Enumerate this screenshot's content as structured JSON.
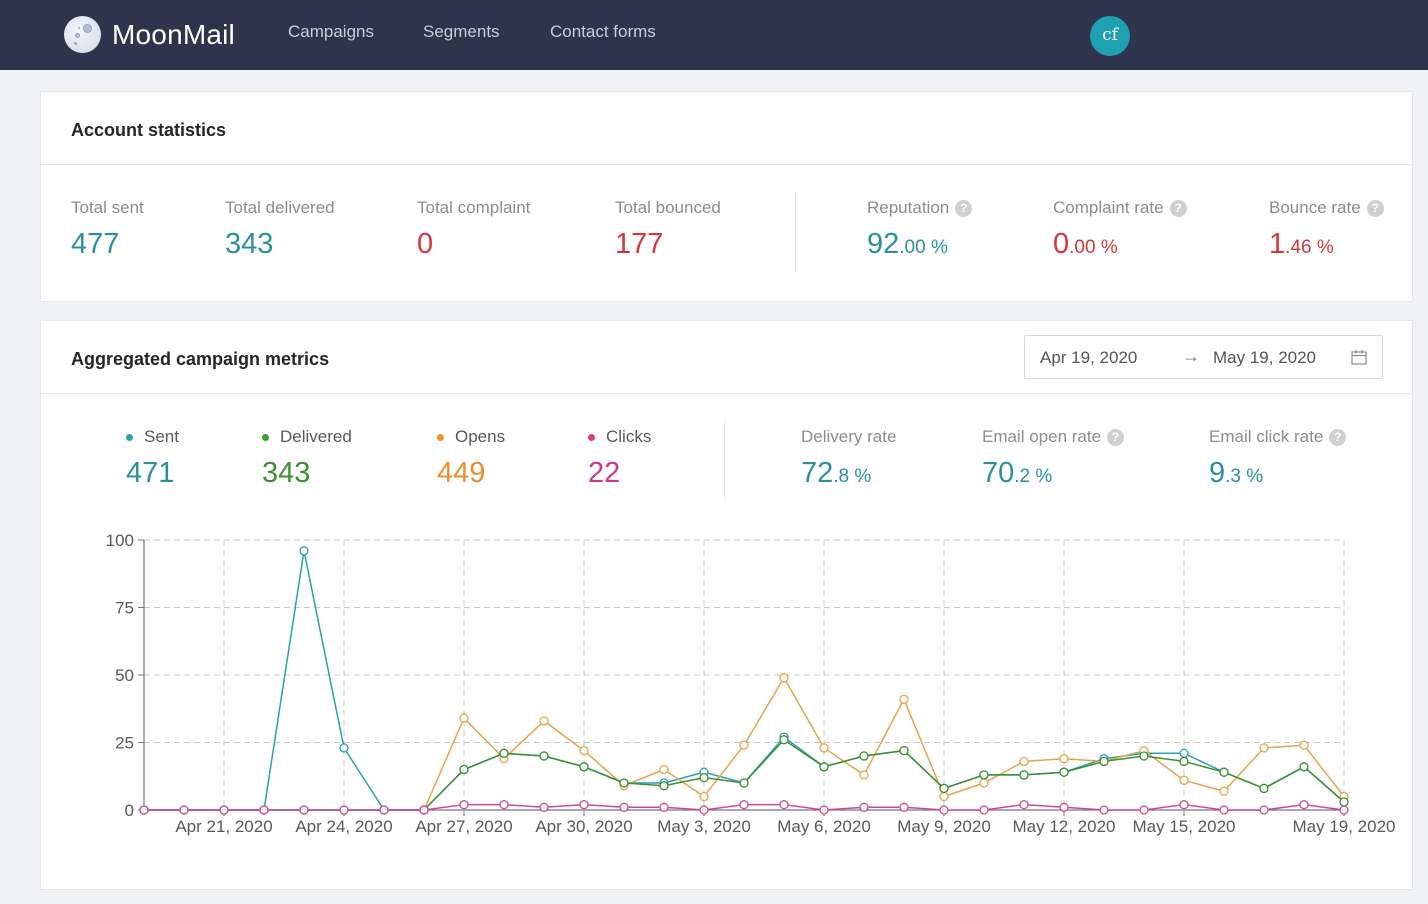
{
  "app": {
    "name": "MoonMail",
    "nav": [
      "Campaigns",
      "Segments",
      "Contact forms"
    ],
    "user_initials": "cf"
  },
  "account_statistics": {
    "title": "Account statistics",
    "totals": [
      {
        "label": "Total sent",
        "value": "477",
        "color": "#2b8f9e"
      },
      {
        "label": "Total delivered",
        "value": "343",
        "color": "#2b8f9e"
      },
      {
        "label": "Total complaint",
        "value": "0",
        "color": "#d4363b"
      },
      {
        "label": "Total bounced",
        "value": "177",
        "color": "#d4363b"
      }
    ],
    "rates": [
      {
        "label": "Reputation",
        "int": "92",
        "dec": ".00 %",
        "color": "#2b8f9e",
        "help": "?"
      },
      {
        "label": "Complaint rate",
        "int": "0",
        "dec": ".00 %",
        "color": "#d4363b",
        "help": "?"
      },
      {
        "label": "Bounce rate",
        "int": "1",
        "dec": ".46 %",
        "color": "#d4363b",
        "help": "?"
      }
    ]
  },
  "campaign_metrics": {
    "title": "Aggregated campaign metrics",
    "date_range": {
      "start": "Apr 19, 2020",
      "arrow": "→",
      "end": "May 19, 2020"
    },
    "counts": [
      {
        "label": "Sent",
        "value": "471",
        "color": "#2aa0b4"
      },
      {
        "label": "Delivered",
        "value": "343",
        "color": "#3aa02a"
      },
      {
        "label": "Opens",
        "value": "449",
        "color": "#f0902a"
      },
      {
        "label": "Clicks",
        "value": "22",
        "color": "#d93a8c"
      }
    ],
    "rates": [
      {
        "label": "Delivery rate",
        "int": "72",
        "dec": ".8 %",
        "help": null
      },
      {
        "label": "Email open rate",
        "int": "70",
        "dec": ".2 %",
        "help": "?"
      },
      {
        "label": "Email click rate",
        "int": "9",
        "dec": ".3 %",
        "help": "?"
      }
    ],
    "rate_color": "#2b8f9e"
  },
  "chart_data": {
    "type": "line",
    "title": "",
    "xlabel": "",
    "ylabel": "",
    "ylim": [
      0,
      100
    ],
    "y_ticks": [
      0,
      25,
      50,
      75,
      100
    ],
    "x": [
      "Apr 19, 2020",
      "Apr 20, 2020",
      "Apr 21, 2020",
      "Apr 22, 2020",
      "Apr 23, 2020",
      "Apr 24, 2020",
      "Apr 25, 2020",
      "Apr 26, 2020",
      "Apr 27, 2020",
      "Apr 28, 2020",
      "Apr 29, 2020",
      "Apr 30, 2020",
      "May 1, 2020",
      "May 2, 2020",
      "May 3, 2020",
      "May 4, 2020",
      "May 5, 2020",
      "May 6, 2020",
      "May 7, 2020",
      "May 8, 2020",
      "May 9, 2020",
      "May 10, 2020",
      "May 11, 2020",
      "May 12, 2020",
      "May 13, 2020",
      "May 14, 2020",
      "May 15, 2020",
      "May 16, 2020",
      "May 17, 2020",
      "May 18, 2020",
      "May 19, 2020"
    ],
    "x_tick_labels": [
      {
        "index": 2,
        "label": "Apr 21, 2020"
      },
      {
        "index": 5,
        "label": "Apr 24, 2020"
      },
      {
        "index": 8,
        "label": "Apr 27, 2020"
      },
      {
        "index": 11,
        "label": "Apr 30, 2020"
      },
      {
        "index": 14,
        "label": "May 3, 2020"
      },
      {
        "index": 17,
        "label": "May 6, 2020"
      },
      {
        "index": 20,
        "label": "May 9, 2020"
      },
      {
        "index": 23,
        "label": "May 12, 2020"
      },
      {
        "index": 26,
        "label": "May 15, 2020"
      },
      {
        "index": 30,
        "label": "May 19, 2020"
      }
    ],
    "grid": true,
    "legend": "none",
    "series": [
      {
        "name": "Sent",
        "color": "#2aa0b4",
        "values": [
          0,
          0,
          0,
          0,
          96,
          23,
          0,
          0,
          15,
          21,
          20,
          16,
          10,
          10,
          14,
          10,
          27,
          16,
          20,
          22,
          8,
          13,
          13,
          14,
          19,
          21,
          21,
          14,
          8,
          16,
          3
        ]
      },
      {
        "name": "Opens",
        "color": "#e8a24a",
        "values": [
          0,
          0,
          0,
          0,
          0,
          0,
          0,
          0,
          34,
          19,
          33,
          22,
          9,
          15,
          5,
          24,
          49,
          23,
          13,
          41,
          5,
          10,
          18,
          19,
          18,
          22,
          11,
          7,
          23,
          24,
          5
        ]
      },
      {
        "name": "Delivered",
        "color": "#3c8f30",
        "values": [
          0,
          0,
          0,
          0,
          0,
          0,
          0,
          0,
          15,
          21,
          20,
          16,
          10,
          9,
          12,
          10,
          26,
          16,
          20,
          22,
          8,
          13,
          13,
          14,
          18,
          20,
          18,
          14,
          8,
          16,
          3
        ]
      },
      {
        "name": "Clicks",
        "color": "#d0479a",
        "values": [
          0,
          0,
          0,
          0,
          0,
          0,
          0,
          0,
          2,
          2,
          1,
          2,
          1,
          1,
          0,
          2,
          2,
          0,
          1,
          1,
          0,
          0,
          2,
          1,
          0,
          0,
          2,
          0,
          0,
          2,
          0
        ]
      }
    ]
  }
}
